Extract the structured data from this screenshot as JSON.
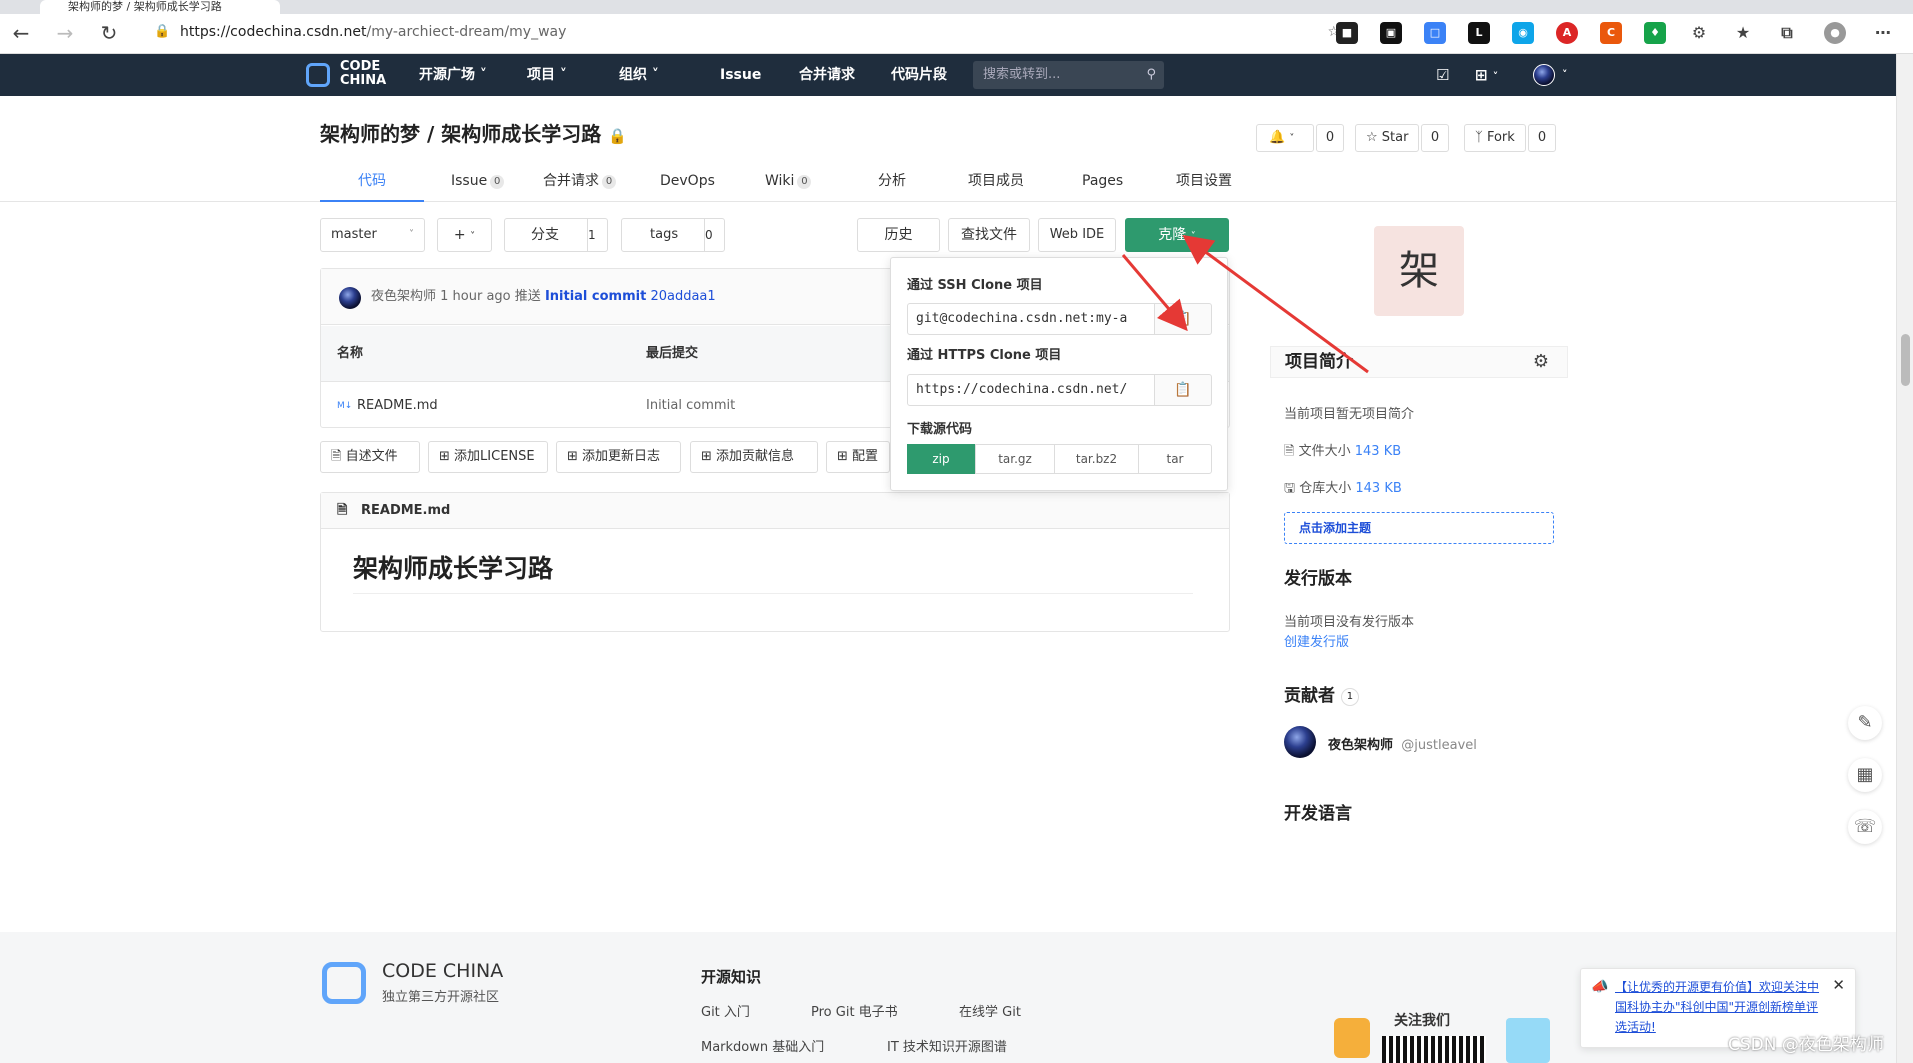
{
  "browser": {
    "tab_title": "架构师的梦 / 架构师成长学习路",
    "url_host": "https://codechina.csdn.net",
    "url_path": "/my-archiect-dream/my_way"
  },
  "topnav": {
    "logo_line1": "CODE",
    "logo_line2": "CHINA",
    "items": [
      "开源广场",
      "项目",
      "组织",
      "Issue",
      "合并请求",
      "代码片段"
    ],
    "search_placeholder": "搜索或转到..."
  },
  "repo": {
    "title": "架构师的梦 / 架构师成长学习路",
    "watch_count": "0",
    "star_label": "Star",
    "star_count": "0",
    "fork_label": "Fork",
    "fork_count": "0"
  },
  "tabs": [
    {
      "label": "代码",
      "count": ""
    },
    {
      "label": "Issue",
      "count": "0"
    },
    {
      "label": "合并请求",
      "count": "0"
    },
    {
      "label": "DevOps",
      "count": ""
    },
    {
      "label": "Wiki",
      "count": "0"
    },
    {
      "label": "分析",
      "count": ""
    },
    {
      "label": "项目成员",
      "count": ""
    },
    {
      "label": "Pages",
      "count": ""
    },
    {
      "label": "项目设置",
      "count": ""
    }
  ],
  "toolbar": {
    "branch": "master",
    "add": "+",
    "branches_label": "分支",
    "branches_count": "1",
    "tags_label": "tags",
    "tags_count": "0",
    "history": "历史",
    "find_file": "查找文件",
    "web_ide": "Web IDE",
    "clone": "克隆"
  },
  "commit": {
    "author": "夜色架构师",
    "time": "1 hour ago",
    "action": "推送",
    "message": "Initial commit",
    "hash": "20addaa1"
  },
  "files": {
    "col_name": "名称",
    "col_last_commit": "最后提交",
    "rows": [
      {
        "name": "README.md",
        "commit": "Initial commit"
      }
    ]
  },
  "actions": [
    "自述文件",
    "添加LICENSE",
    "添加更新日志",
    "添加贡献信息",
    "配置"
  ],
  "readme": {
    "filename": "README.md",
    "heading": "架构师成长学习路"
  },
  "clone_panel": {
    "ssh_label": "通过 SSH Clone 项目",
    "ssh_url": "git@codechina.csdn.net:my-a",
    "https_label": "通过 HTTPS Clone 项目",
    "https_url": "https://codechina.csdn.net/",
    "download_label": "下载源代码",
    "formats": [
      "zip",
      "tar.gz",
      "tar.bz2",
      "tar"
    ]
  },
  "sidebar": {
    "avatar_char": "架",
    "intro_title": "项目简介",
    "no_intro": "当前项目暂无项目简介",
    "file_size_label": "文件大小",
    "file_size": "143 KB",
    "repo_size_label": "仓库大小",
    "repo_size": "143 KB",
    "add_topic": "点击添加主题",
    "release_title": "发行版本",
    "no_release": "当前项目没有发行版本",
    "create_release": "创建发行版",
    "contributors_title": "贡献者",
    "contributors_count": "1",
    "contributor_name": "夜色架构师",
    "contributor_handle": "@justleavel",
    "language_title": "开发语言"
  },
  "footer": {
    "brand": "CODE CHINA",
    "tagline": "独立第三方开源社区",
    "knowledge_title": "开源知识",
    "links": [
      "Git 入门",
      "Pro Git 电子书",
      "在线学 Git",
      "Markdown 基础入门",
      "IT 技术知识开源图谱"
    ],
    "follow": "关注我们",
    "notice": "【让优秀的开源更有价值】欢迎关注中国科协主办\"科创中国\"开源创新榜单评选活动!",
    "watermark": "CSDN @夜色架构师"
  },
  "colors": {
    "nav_bg": "#1f2d3d",
    "accent": "#3b82f6",
    "clone_green": "#2e9a6e",
    "arrow": "#e53935"
  }
}
